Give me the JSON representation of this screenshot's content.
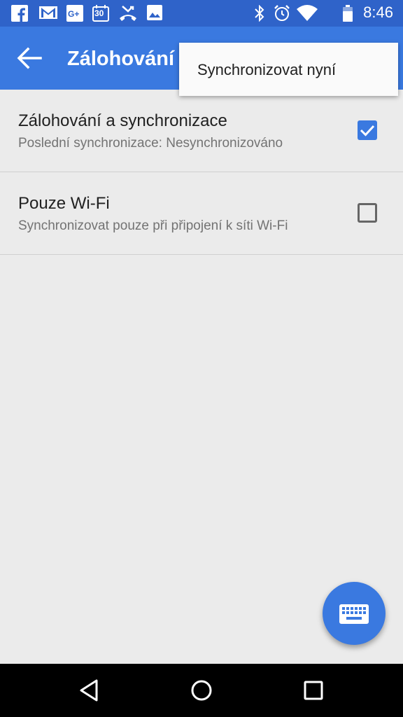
{
  "status_bar": {
    "time": "8:46",
    "calendar_day": "30",
    "left_icons": [
      "facebook-icon",
      "gmail-icon",
      "google-plus-icon",
      "calendar-icon",
      "missed-call-icon",
      "photos-icon"
    ],
    "right_icons": [
      "bluetooth-icon",
      "alarm-icon",
      "wifi-icon",
      "battery-icon"
    ]
  },
  "app_bar": {
    "title": "Zálohování",
    "back_icon": "arrow-back-icon"
  },
  "overflow_menu": {
    "items": [
      {
        "label": "Synchronizovat nyní"
      }
    ]
  },
  "preferences": [
    {
      "title": "Zálohování a synchronizace",
      "summary": "Poslední synchronizace: Nesynchronizováno",
      "checked": true
    },
    {
      "title": "Pouze Wi-Fi",
      "summary": "Synchronizovat pouze při připojení k síti Wi-Fi",
      "checked": false
    }
  ],
  "fab": {
    "icon": "keyboard-icon"
  },
  "nav_bar": {
    "icons": [
      "back-triangle-icon",
      "home-circle-icon",
      "recents-square-icon"
    ]
  },
  "colors": {
    "status_bar": "#2f63c9",
    "app_bar": "#3a79e0",
    "accent": "#3a79e0",
    "background": "#ebebeb"
  }
}
